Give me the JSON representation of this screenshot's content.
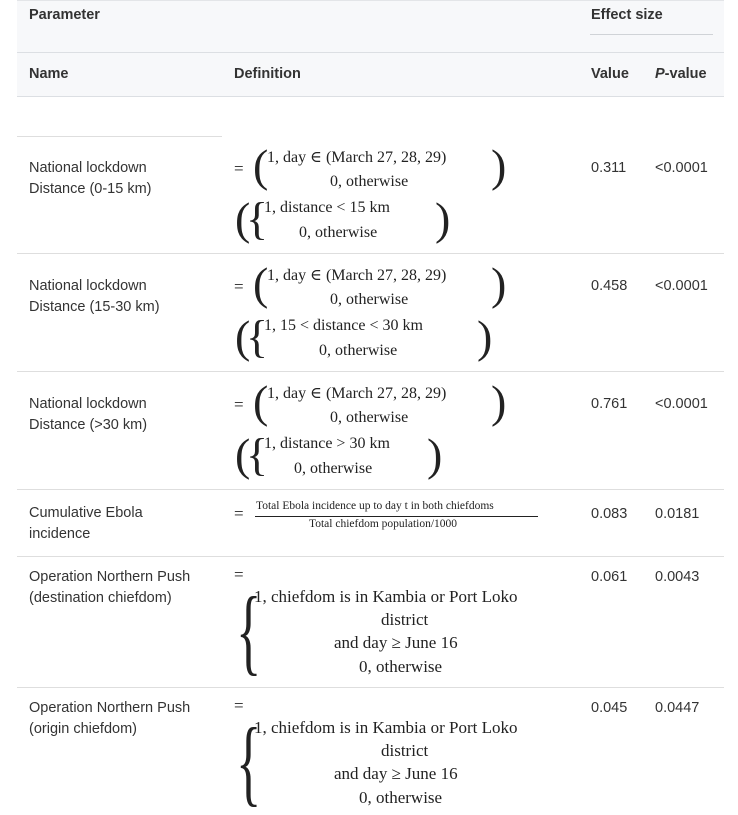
{
  "header": {
    "parameter": "Parameter",
    "effect_size": "Effect size",
    "name": "Name",
    "definition": "Definition",
    "value": "Value",
    "p_value_italic": "P",
    "p_value_rest": "-value"
  },
  "rows": [
    {
      "name_l1": "National lockdown",
      "name_l2": "Distance (0-15 km)",
      "eq": "=",
      "top_l1": "1, day ∈ (March 27, 28, 29)",
      "top_l2": "0, otherwise",
      "bot_l1": "1, distance < 15 km",
      "bot_l2": "0, otherwise",
      "value": "0.311",
      "p": "<0.0001"
    },
    {
      "name_l1": "National lockdown",
      "name_l2": "Distance (15-30 km)",
      "eq": "=",
      "top_l1": "1, day ∈ (March 27, 28, 29)",
      "top_l2": "0, otherwise",
      "bot_l1": "1, 15 < distance < 30 km",
      "bot_l2": "0, otherwise",
      "value": "0.458",
      "p": "<0.0001"
    },
    {
      "name_l1": "National lockdown",
      "name_l2": "Distance (>30 km)",
      "eq": "=",
      "top_l1": "1, day ∈ (March 27, 28, 29)",
      "top_l2": "0, otherwise",
      "bot_l1": "1, distance > 30 km",
      "bot_l2": "0, otherwise",
      "value": "0.761",
      "p": "<0.0001"
    },
    {
      "name_l1": "Cumulative Ebola",
      "name_l2": "incidence",
      "eq": "=",
      "numerator": "Total Ebola incidence up to day t in both chiefdoms",
      "denominator": "Total chiefdom population/1000",
      "value": "0.083",
      "p": "0.0181"
    },
    {
      "name_l1": "Operation Northern Push",
      "name_l2": "(destination chiefdom)",
      "eq": "=",
      "l1": "1, chiefdom is in Kambia or Port Loko",
      "l2": "district",
      "l3": "and day ≥ June 16",
      "l4": "0, otherwise",
      "value": "0.061",
      "p": "0.0043"
    },
    {
      "name_l1": "Operation Northern Push",
      "name_l2": "(origin chiefdom)",
      "eq": "=",
      "l1": "1, chiefdom is in Kambia or Port Loko",
      "l2": "district",
      "l3": "and day ≥ June 16",
      "l4": "0, otherwise",
      "value": "0.045",
      "p": "0.0447"
    }
  ]
}
